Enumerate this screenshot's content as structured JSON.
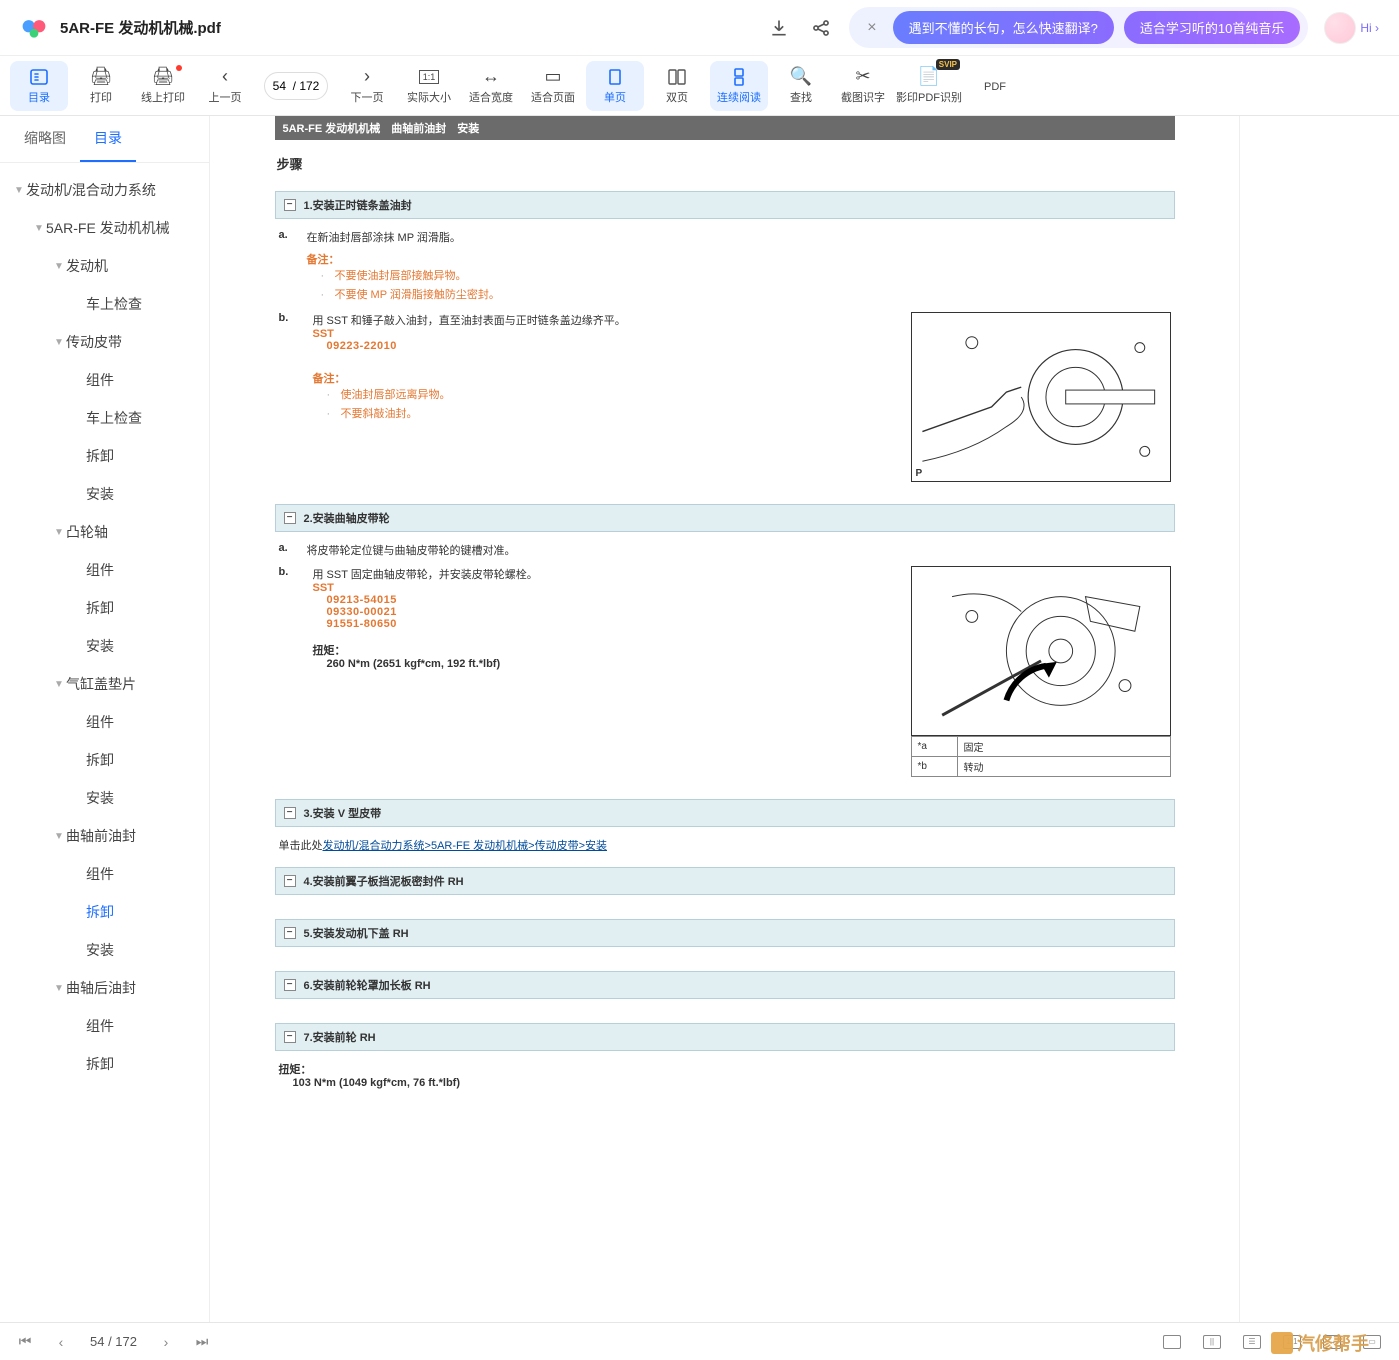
{
  "title_bar": {
    "doc_name": "5AR-FE 发动机机械.pdf",
    "promo_close": "×",
    "promo1": "遇到不懂的长句，怎么快速翻译?",
    "promo2": "适合学习听的10首纯音乐",
    "hi": "Hi ›"
  },
  "toolbar": {
    "toc": "目录",
    "print": "打印",
    "online_print": "线上打印",
    "prev": "上一页",
    "page_field": "54  / 172",
    "next": "下一页",
    "actual": "实际大小",
    "fit_w": "适合宽度",
    "fit_p": "适合页面",
    "single": "单页",
    "double": "双页",
    "cont": "连续阅读",
    "search": "查找",
    "ocr": "截图识字",
    "scan": "影印PDF识别",
    "pdf_more": "PDF",
    "svip": "SVIP"
  },
  "sidebar": {
    "tabs": {
      "thumb": "缩略图",
      "toc": "目录"
    },
    "items": [
      {
        "label": "发动机/混合动力系统",
        "depth": 0,
        "caret": "▼"
      },
      {
        "label": "5AR-FE 发动机机械",
        "depth": 1,
        "caret": "▼"
      },
      {
        "label": "发动机",
        "depth": 2,
        "caret": "▼"
      },
      {
        "label": "车上检查",
        "depth": 3,
        "caret": ""
      },
      {
        "label": "传动皮带",
        "depth": 2,
        "caret": "▼"
      },
      {
        "label": "组件",
        "depth": 3,
        "caret": ""
      },
      {
        "label": "车上检查",
        "depth": 3,
        "caret": ""
      },
      {
        "label": "拆卸",
        "depth": 3,
        "caret": ""
      },
      {
        "label": "安装",
        "depth": 3,
        "caret": ""
      },
      {
        "label": "凸轮轴",
        "depth": 2,
        "caret": "▼"
      },
      {
        "label": "组件",
        "depth": 3,
        "caret": ""
      },
      {
        "label": "拆卸",
        "depth": 3,
        "caret": ""
      },
      {
        "label": "安装",
        "depth": 3,
        "caret": ""
      },
      {
        "label": "气缸盖垫片",
        "depth": 2,
        "caret": "▼"
      },
      {
        "label": "组件",
        "depth": 3,
        "caret": ""
      },
      {
        "label": "拆卸",
        "depth": 3,
        "caret": ""
      },
      {
        "label": "安装",
        "depth": 3,
        "caret": ""
      },
      {
        "label": "曲轴前油封",
        "depth": 2,
        "caret": "▼"
      },
      {
        "label": "组件",
        "depth": 3,
        "caret": ""
      },
      {
        "label": "拆卸",
        "depth": 3,
        "caret": "",
        "selected": true
      },
      {
        "label": "安装",
        "depth": 3,
        "caret": ""
      },
      {
        "label": "曲轴后油封",
        "depth": 2,
        "caret": "▼"
      },
      {
        "label": "组件",
        "depth": 3,
        "caret": ""
      },
      {
        "label": "拆卸",
        "depth": 3,
        "caret": ""
      }
    ]
  },
  "doc": {
    "header_bar": "5AR-FE 发动机机械　曲轴前油封　安装",
    "steps_heading": "步骤",
    "s1": {
      "title": "1.安装正时链条盖油封",
      "a": "在新油封唇部涂抹 MP 润滑脂。",
      "note_lbl": "备注：",
      "note1": "不要使油封唇部接触异物。",
      "note2": "不要使 MP 润滑脂接触防尘密封。",
      "b": "用 SST 和锤子敲入油封，直至油封表面与正时链条盖边缘齐平。",
      "sst": "SST",
      "sst_code": "09223-22010",
      "note_lbl2": "备注：",
      "note3": "使油封唇部远离异物。",
      "note4": "不要斜敲油封。"
    },
    "s2": {
      "title": "2.安装曲轴皮带轮",
      "a": "将皮带轮定位键与曲轴皮带轮的键槽对准。",
      "b": "用 SST 固定曲轴皮带轮，并安装皮带轮螺栓。",
      "sst": "SST",
      "code1": "09213-54015",
      "code2": "09330-00021",
      "code3": "91551-80650",
      "torque_lbl": "扭矩：",
      "torque_val": "260 N*m (2651 kgf*cm, 192 ft.*lbf)",
      "tbl_a_k": "*a",
      "tbl_a_v": "固定",
      "tbl_b_k": "*b",
      "tbl_b_v": "转动"
    },
    "s3": {
      "title": "3.安装 V 型皮带"
    },
    "link_pre": "单击此处",
    "link_text": "发动机/混合动力系统>5AR-FE 发动机机械>传动皮带>安装",
    "s4": {
      "title": "4.安装前翼子板挡泥板密封件 RH"
    },
    "s5": {
      "title": "5.安装发动机下盖 RH"
    },
    "s6": {
      "title": "6.安装前轮轮罩加长板 RH"
    },
    "s7": {
      "title": "7.安装前轮 RH"
    },
    "torque7_lbl": "扭矩：",
    "torque7_val": "103 N*m (1049 kgf*cm, 76 ft.*lbf)"
  },
  "bottom": {
    "page": "54  / 172",
    "v1": "1:1"
  },
  "watermark": "汽修帮手"
}
